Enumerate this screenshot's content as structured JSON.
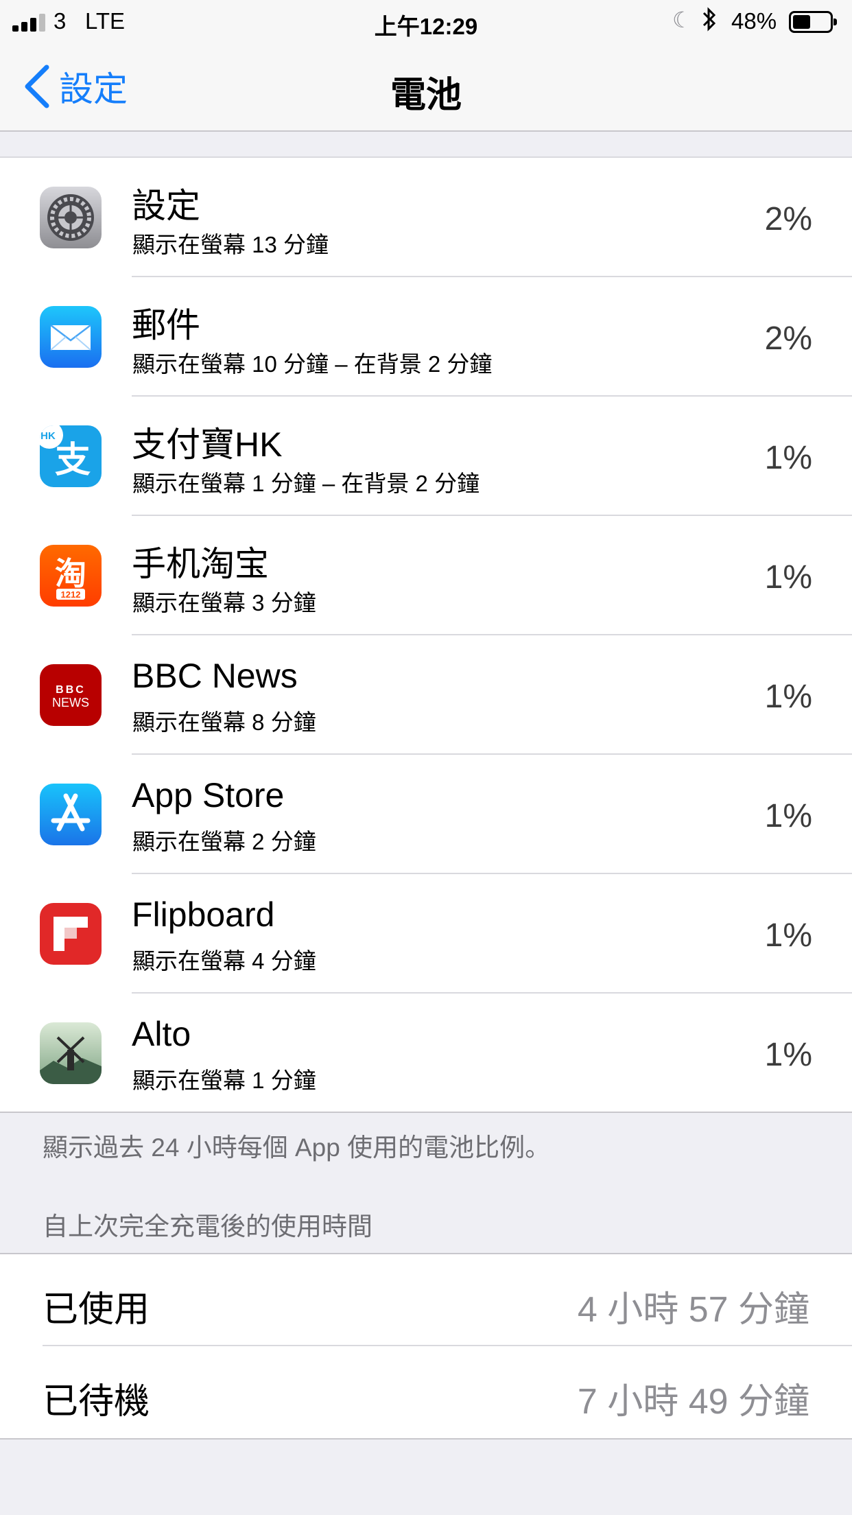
{
  "status_bar": {
    "carrier": "3",
    "network": "LTE",
    "time": "上午12:29",
    "battery_percent": "48%",
    "battery_level": 0.48
  },
  "nav": {
    "back_label": "設定",
    "title": "電池"
  },
  "apps": [
    {
      "name": "設定",
      "detail": "顯示在螢幕 13 分鐘",
      "percent": "2%",
      "icon": "settings-app-icon"
    },
    {
      "name": "郵件",
      "detail": "顯示在螢幕 10 分鐘 – 在背景 2 分鐘",
      "percent": "2%",
      "icon": "mail-app-icon"
    },
    {
      "name": "支付寶HK",
      "detail": "顯示在螢幕 1 分鐘 – 在背景 2 分鐘",
      "percent": "1%",
      "icon": "alipay-hk-app-icon"
    },
    {
      "name": "手机淘宝",
      "detail": "顯示在螢幕 3 分鐘",
      "percent": "1%",
      "icon": "taobao-app-icon"
    },
    {
      "name": "BBC News",
      "detail": "顯示在螢幕 8 分鐘",
      "percent": "1%",
      "icon": "bbc-news-app-icon"
    },
    {
      "name": "App Store",
      "detail": "顯示在螢幕 2 分鐘",
      "percent": "1%",
      "icon": "app-store-app-icon"
    },
    {
      "name": "Flipboard",
      "detail": "顯示在螢幕 4 分鐘",
      "percent": "1%",
      "icon": "flipboard-app-icon"
    },
    {
      "name": "Alto",
      "detail": "顯示在螢幕 1 分鐘",
      "percent": "1%",
      "icon": "alto-app-icon"
    }
  ],
  "icon_text": {
    "taobao_char": "淘",
    "taobao_badge": "1212",
    "bbc_line1": "BBC",
    "bbc_line2": "NEWS",
    "alipay_char": "支",
    "alipay_badge": "HK"
  },
  "footnote": "顯示過去 24 小時每個 App 使用的電池比例。",
  "section_header": "自上次完全充電後的使用時間",
  "usage": [
    {
      "label": "已使用",
      "value": "4 小時 57 分鐘"
    },
    {
      "label": "已待機",
      "value": "7 小時 49 分鐘"
    }
  ],
  "colors": {
    "accent": "#157efb",
    "mail": "#1a8cf5",
    "alipay": "#1aa3e8",
    "taobao": "#ff5000",
    "bbc": "#b80000",
    "appstore": "#1a8df5",
    "flipboard": "#e12828"
  }
}
